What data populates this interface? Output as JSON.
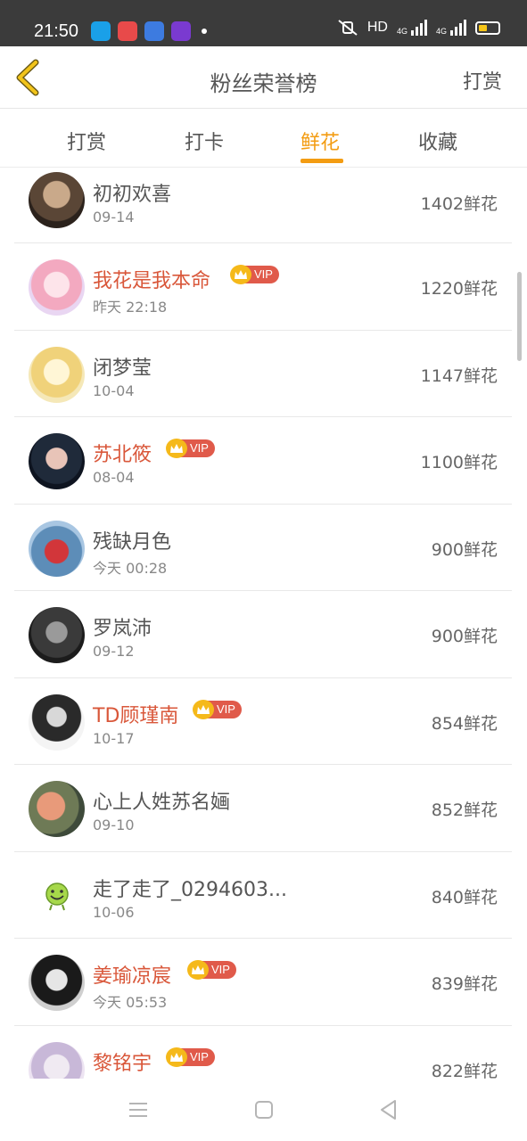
{
  "status_bar": {
    "time": "21:50",
    "network_label": "HD",
    "signal1": "4G",
    "signal2": "4G",
    "icons": [
      "qq-icon",
      "music-icon",
      "video-app-icon",
      "player-icon"
    ]
  },
  "header": {
    "title": "粉丝荣誉榜",
    "right_action": "打赏"
  },
  "tabs": [
    {
      "label": "打赏",
      "active": false
    },
    {
      "label": "打卡",
      "active": false
    },
    {
      "label": "鲜花",
      "active": true
    },
    {
      "label": "收藏",
      "active": false
    }
  ],
  "vip_label": "VIP",
  "fans": [
    {
      "name": "初初欢喜",
      "date": "09-14",
      "amount": "1402鲜花",
      "vip": false
    },
    {
      "name": "我花是我本命",
      "date": "昨天 22:18",
      "amount": "1220鲜花",
      "vip": true
    },
    {
      "name": "闭梦莹",
      "date": "10-04",
      "amount": "1147鲜花",
      "vip": false
    },
    {
      "name": "苏北筱",
      "date": "08-04",
      "amount": "1100鲜花",
      "vip": true
    },
    {
      "name": "残缺月色",
      "date": "今天 00:28",
      "amount": "900鲜花",
      "vip": false
    },
    {
      "name": "罗岚沛",
      "date": "09-12",
      "amount": "900鲜花",
      "vip": false
    },
    {
      "name": "TD顾瑾南",
      "date": "10-17",
      "amount": "854鲜花",
      "vip": true
    },
    {
      "name": "心上人姓苏名婳",
      "date": "09-10",
      "amount": "852鲜花",
      "vip": false
    },
    {
      "name": "走了走了_0294603...",
      "date": "10-06",
      "amount": "840鲜花",
      "vip": false
    },
    {
      "name": "姜瑜凉宸",
      "date": "今天 05:53",
      "amount": "839鲜花",
      "vip": true
    },
    {
      "name": "黎铭宇",
      "date": "",
      "amount": "822鲜花",
      "vip": true
    }
  ],
  "colors": {
    "accent": "#f39c12",
    "vip_name": "#d9573a",
    "vip_tag": "#e05a4a",
    "crown": "#f5b91a"
  }
}
